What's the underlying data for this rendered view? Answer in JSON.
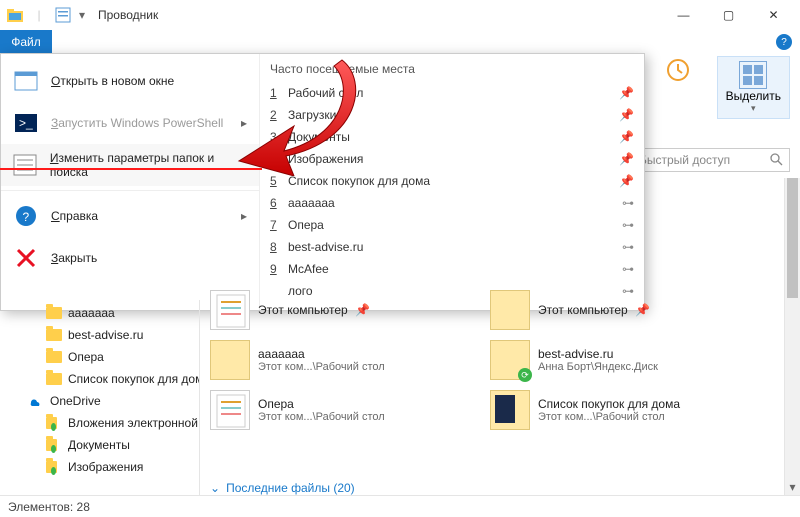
{
  "title": "Проводник",
  "file_tab": "Файл",
  "ribbon": {
    "invert": "",
    "select_all": "Выделить"
  },
  "search": {
    "placeholder": "Быстрый доступ"
  },
  "file_menu": {
    "items": [
      {
        "label": "Открыть в новом окне",
        "kind": "window",
        "disabled": false,
        "arrow": false
      },
      {
        "label": "Запустить Windows PowerShell",
        "kind": "ps",
        "disabled": true,
        "arrow": true
      },
      {
        "label": "Изменить параметры папок и поиска",
        "kind": "opts",
        "disabled": false,
        "arrow": false,
        "selected": true
      },
      {
        "label": "Справка",
        "kind": "help",
        "disabled": false,
        "arrow": true
      },
      {
        "label": "Закрыть",
        "kind": "close",
        "disabled": false,
        "arrow": false
      }
    ],
    "mru_header": "Часто посещаемые места",
    "mru": [
      {
        "n": "1",
        "label": "Рабочий стол",
        "pinned": true
      },
      {
        "n": "2",
        "label": "Загрузки",
        "pinned": true
      },
      {
        "n": "3",
        "label": "Документы",
        "pinned": true
      },
      {
        "n": "4",
        "label": "Изображения",
        "pinned": true
      },
      {
        "n": "5",
        "label": "Список покупок для дома",
        "pinned": true
      },
      {
        "n": "6",
        "label": "aaaaaaa",
        "pinned": false
      },
      {
        "n": "7",
        "label": "Опера",
        "pinned": false
      },
      {
        "n": "8",
        "label": "best-advise.ru",
        "pinned": false
      },
      {
        "n": "9",
        "label": "McAfee",
        "pinned": false
      },
      {
        "n": "",
        "label": "лого",
        "pinned": false
      }
    ]
  },
  "tree": [
    {
      "label": "aaaaaaa",
      "kind": "folder",
      "indent": true
    },
    {
      "label": "best-advise.ru",
      "kind": "folder",
      "indent": true
    },
    {
      "label": "Опера",
      "kind": "folder",
      "indent": true
    },
    {
      "label": "Список покупок для дома",
      "kind": "folder",
      "indent": true
    },
    {
      "label": "OneDrive",
      "kind": "onedrive",
      "indent": false
    },
    {
      "label": "Вложения электронной",
      "kind": "folder-green",
      "indent": true
    },
    {
      "label": "Документы",
      "kind": "folder-green",
      "indent": true
    },
    {
      "label": "Изображения",
      "kind": "folder-green",
      "indent": true
    }
  ],
  "content": [
    {
      "name": "Этот компьютер",
      "sub": "",
      "thumb": "doc",
      "pin": true
    },
    {
      "name": "Этот компьютер",
      "sub": "",
      "thumb": "folder",
      "pin": true
    },
    {
      "name": "aaaaaaa",
      "sub": "Этот ком...\\Рабочий стол",
      "thumb": "folder"
    },
    {
      "name": "best-advise.ru",
      "sub": "Анна Борт\\Яндекс.Диск",
      "thumb": "folder-sync"
    },
    {
      "name": "Опера",
      "sub": "Этот ком...\\Рабочий стол",
      "thumb": "doc"
    },
    {
      "name": "Список покупок для дома",
      "sub": "Этот ком...\\Рабочий стол",
      "thumb": "folder-dark"
    }
  ],
  "recent_header": "Последние файлы (20)",
  "status": "Элементов: 28"
}
